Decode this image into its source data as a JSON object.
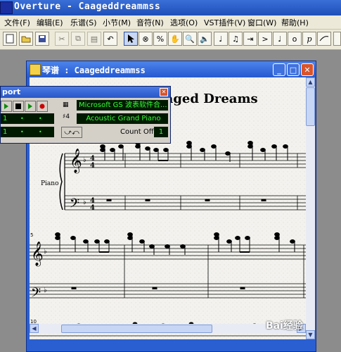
{
  "app": {
    "title": "Overture - Caageddreammss"
  },
  "menu": [
    "文件(F)",
    "编辑(E)",
    "乐谱(S)",
    "小节(M)",
    "音符(N)",
    "选项(O)",
    "VST插件(V)",
    "窗口(W)",
    "帮助(H)"
  ],
  "score_window": {
    "title": "琴谱 : Caageddreammss",
    "piece_title": "Caged Dreams",
    "instrument_label": "Piano",
    "measure_numbers": [
      "5",
      "10"
    ]
  },
  "transport": {
    "title": "port",
    "device": "Microsoft GS 波表软件合...",
    "instrument": "Acoustic Grand Piano",
    "count_off_label": "Count Off",
    "count_off_value": "1",
    "counter_1": "1",
    "counter_2": "1"
  },
  "watermark": "Bai经验",
  "colors": {
    "lcd_text": "#38ff38",
    "lcd_bg": "#001a00",
    "titlebar": "#2357cf"
  }
}
